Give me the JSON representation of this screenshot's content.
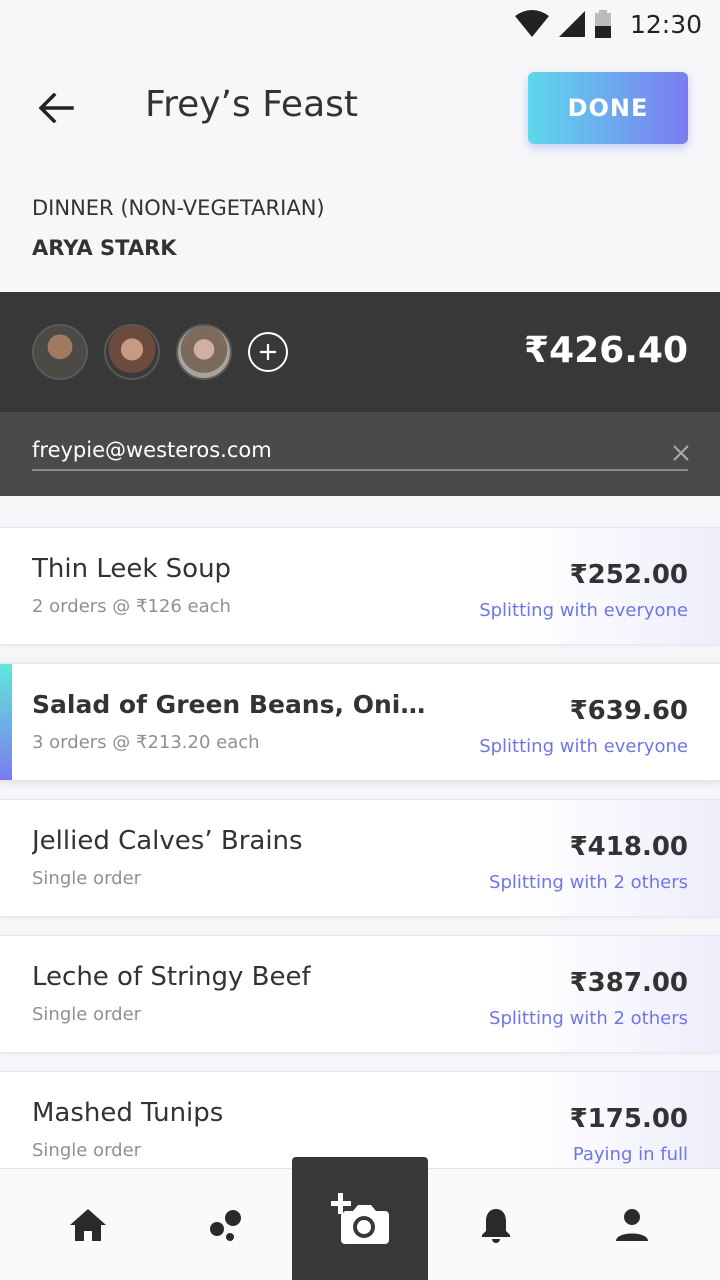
{
  "status_bar": {
    "time": "12:30"
  },
  "header": {
    "title": "Frey’s Feast",
    "done_label": "DONE"
  },
  "meal": {
    "type": "DINNER (NON-VEGETARIAN)",
    "person": "ARYA STARK"
  },
  "summary": {
    "total": "₹426.40"
  },
  "email": {
    "value": "freypie@westeros.com"
  },
  "items": [
    {
      "name": "Thin Leek Soup",
      "sub": "2 orders @ ₹126 each",
      "price": "₹252.00",
      "split": "Splitting with everyone"
    },
    {
      "name": "Salad of Green Beans, Onions...",
      "sub": "3 orders @ ₹213.20 each",
      "price": "₹639.60",
      "split": "Splitting with everyone"
    },
    {
      "name": "Jellied Calves’ Brains",
      "sub": "Single order",
      "price": "₹418.00",
      "split": "Splitting with 2 others"
    },
    {
      "name": "Leche of Stringy Beef",
      "sub": "Single order",
      "price": "₹387.00",
      "split": "Splitting with 2 others"
    },
    {
      "name": "Mashed Tunips",
      "sub": "Single order",
      "price": "₹175.00",
      "split": "Paying in full"
    }
  ],
  "nav": {
    "items": [
      "home-icon",
      "bubbles-icon",
      "add-photo-icon",
      "bell-icon",
      "person-icon"
    ]
  },
  "colors": {
    "accent_start": "#5fd8ec",
    "accent_end": "#7a7cf0",
    "split_text": "#6e76e8",
    "dark_panel": "#383838"
  }
}
